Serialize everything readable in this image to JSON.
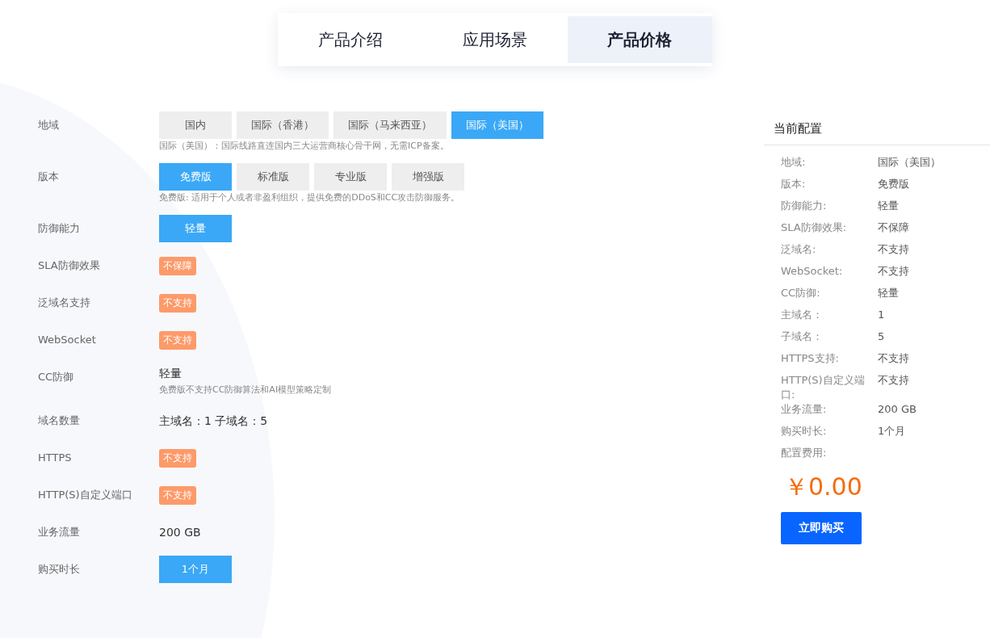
{
  "tabs": [
    {
      "label": "产品介绍",
      "selected": false
    },
    {
      "label": "应用场景",
      "selected": false
    },
    {
      "label": "产品价格",
      "selected": true
    }
  ],
  "form": [
    {
      "kind": "options",
      "label": "地域",
      "options": [
        {
          "label": "国内",
          "selected": false
        },
        {
          "label": "国际（香港）",
          "selected": false
        },
        {
          "label": "国际（马来西亚）",
          "selected": false
        },
        {
          "label": "国际（美国）",
          "selected": true
        }
      ],
      "note": "国际（美国）：国际线路直连国内三大运营商核心骨干网，无需ICP备案。"
    },
    {
      "kind": "options",
      "label": "版本",
      "options": [
        {
          "label": "免费版",
          "selected": true
        },
        {
          "label": "标准版",
          "selected": false
        },
        {
          "label": "专业版",
          "selected": false
        },
        {
          "label": "增强版",
          "selected": false
        }
      ],
      "note": "免费版: 适用于个人或者非盈利组织，提供免费的DDoS和CC攻击防御服务。"
    },
    {
      "kind": "options",
      "label": "防御能力",
      "options": [
        {
          "label": "轻量",
          "selected": true
        }
      ]
    },
    {
      "kind": "tag",
      "label": "SLA防御效果",
      "value": "不保障"
    },
    {
      "kind": "tag",
      "label": "泛域名支持",
      "value": "不支持"
    },
    {
      "kind": "tag",
      "label": "WebSocket",
      "value": "不支持"
    },
    {
      "kind": "text",
      "label": "CC防御",
      "value": "轻量",
      "note": "免费版不支持CC防御算法和AI模型策略定制"
    },
    {
      "kind": "text",
      "label": "域名数量",
      "value": "主域名：1 子域名：5"
    },
    {
      "kind": "tag",
      "label": "HTTPS",
      "value": "不支持"
    },
    {
      "kind": "tag",
      "label": "HTTP(S)自定义端口",
      "value": "不支持"
    },
    {
      "kind": "text",
      "label": "业务流量",
      "value": "200 GB"
    },
    {
      "kind": "options",
      "label": "购买时长",
      "options": [
        {
          "label": "1个月",
          "selected": true
        }
      ]
    }
  ],
  "summary": {
    "title": "当前配置",
    "rows": [
      {
        "label": "地域:",
        "value": "国际（美国）"
      },
      {
        "label": "版本:",
        "value": "免费版"
      },
      {
        "label": "防御能力:",
        "value": "轻量"
      },
      {
        "label": "SLA防御效果:",
        "value": "不保障"
      },
      {
        "label": "泛域名:",
        "value": "不支持"
      },
      {
        "label": "WebSocket:",
        "value": "不支持"
      },
      {
        "label": "CC防御:",
        "value": "轻量"
      },
      {
        "label": "主域名：",
        "value": "1"
      },
      {
        "label": "子域名：",
        "value": "5"
      },
      {
        "label": "HTTPS支持:",
        "value": "不支持"
      },
      {
        "label": "HTTP(S)自定义端口:",
        "value": "不支持"
      },
      {
        "label": "业务流量:",
        "value": "200 GB"
      },
      {
        "label": "购买时长:",
        "value": "1个月"
      }
    ],
    "fee_label": "配置费用:",
    "price": "￥0.00",
    "buy_button": "立即购买"
  }
}
